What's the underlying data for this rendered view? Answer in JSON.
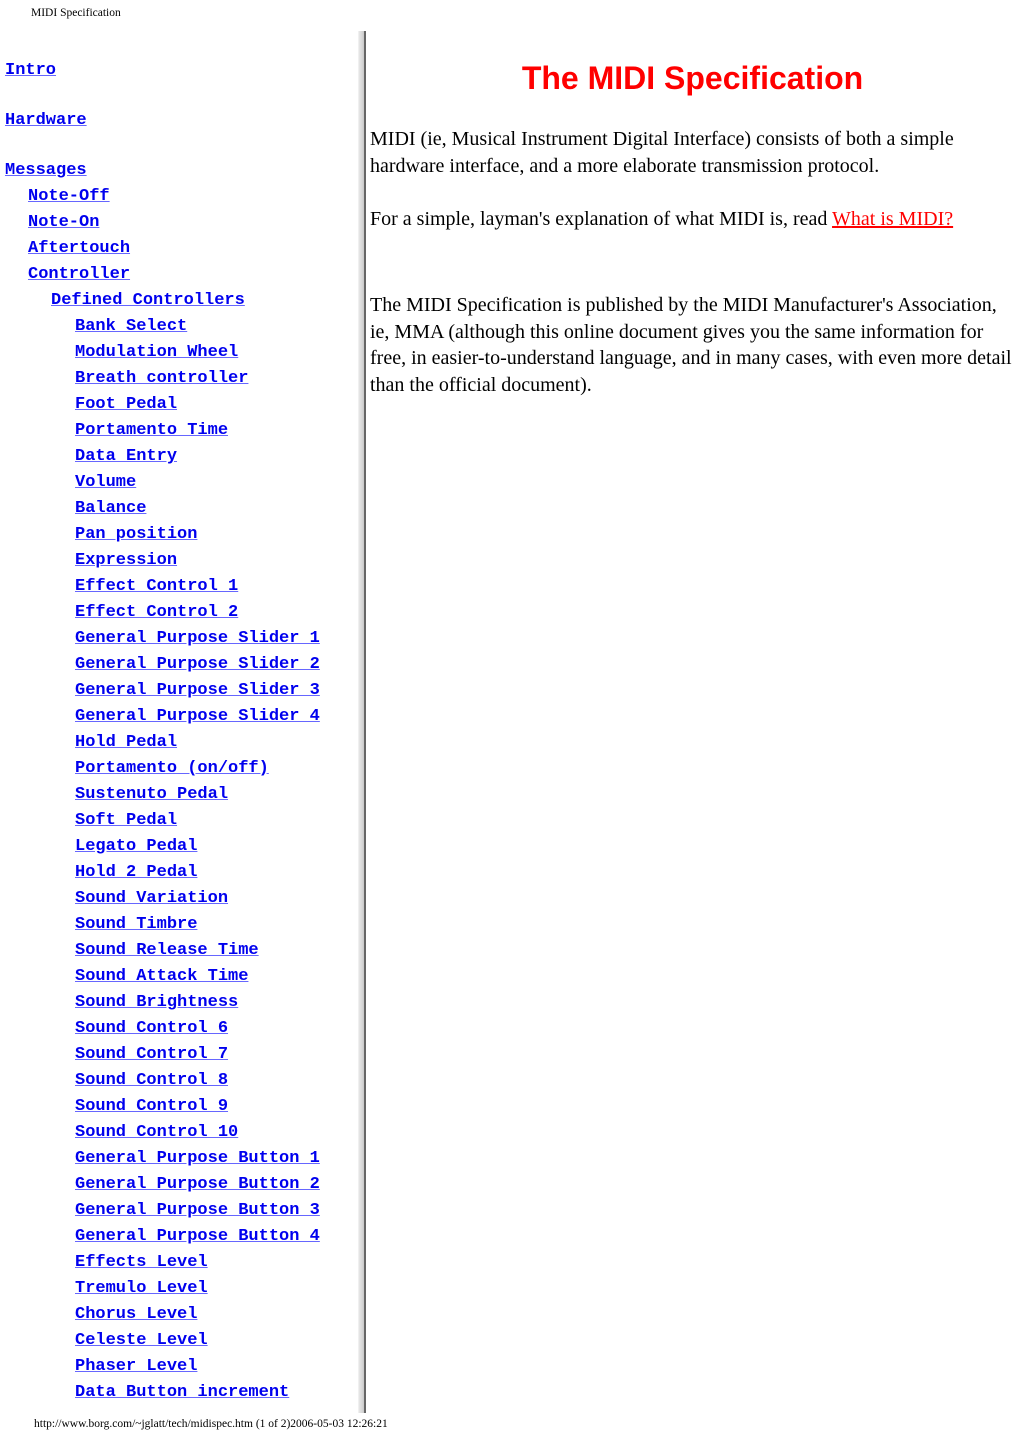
{
  "header": {
    "title": "MIDI Specification"
  },
  "nav": {
    "items": [
      {
        "label": "Intro",
        "level": 0,
        "gap": true
      },
      {
        "label": "Hardware",
        "level": 0,
        "gap": true
      },
      {
        "label": "Messages",
        "level": 0
      },
      {
        "label": "Note-Off",
        "level": 1
      },
      {
        "label": "Note-On",
        "level": 1
      },
      {
        "label": "Aftertouch",
        "level": 1
      },
      {
        "label": "Controller",
        "level": 1
      },
      {
        "label": "Defined Controllers",
        "level": 2
      },
      {
        "label": "Bank Select",
        "level": 3
      },
      {
        "label": "Modulation Wheel",
        "level": 3
      },
      {
        "label": "Breath controller",
        "level": 3
      },
      {
        "label": "Foot Pedal",
        "level": 3
      },
      {
        "label": "Portamento Time",
        "level": 3
      },
      {
        "label": "Data Entry",
        "level": 3
      },
      {
        "label": "Volume",
        "level": 3
      },
      {
        "label": "Balance",
        "level": 3
      },
      {
        "label": "Pan position",
        "level": 3
      },
      {
        "label": "Expression",
        "level": 3
      },
      {
        "label": "Effect Control 1",
        "level": 3
      },
      {
        "label": "Effect Control 2",
        "level": 3
      },
      {
        "label": "General Purpose Slider 1",
        "level": 3
      },
      {
        "label": "General Purpose Slider 2",
        "level": 3
      },
      {
        "label": "General Purpose Slider 3",
        "level": 3
      },
      {
        "label": "General Purpose Slider 4",
        "level": 3
      },
      {
        "label": "Hold Pedal",
        "level": 3
      },
      {
        "label": "Portamento (on/off)",
        "level": 3
      },
      {
        "label": "Sustenuto Pedal",
        "level": 3
      },
      {
        "label": "Soft Pedal",
        "level": 3
      },
      {
        "label": "Legato Pedal",
        "level": 3
      },
      {
        "label": "Hold 2 Pedal",
        "level": 3
      },
      {
        "label": "Sound Variation",
        "level": 3
      },
      {
        "label": "Sound Timbre",
        "level": 3
      },
      {
        "label": "Sound Release Time",
        "level": 3
      },
      {
        "label": "Sound Attack Time",
        "level": 3
      },
      {
        "label": "Sound Brightness",
        "level": 3
      },
      {
        "label": "Sound Control 6",
        "level": 3
      },
      {
        "label": "Sound Control 7",
        "level": 3
      },
      {
        "label": "Sound Control 8",
        "level": 3
      },
      {
        "label": "Sound Control 9",
        "level": 3
      },
      {
        "label": "Sound Control 10",
        "level": 3
      },
      {
        "label": "General Purpose Button 1",
        "level": 3
      },
      {
        "label": "General Purpose Button 2",
        "level": 3
      },
      {
        "label": "General Purpose Button 3",
        "level": 3
      },
      {
        "label": "General Purpose Button 4",
        "level": 3
      },
      {
        "label": "Effects Level",
        "level": 3
      },
      {
        "label": "Tremulo Level",
        "level": 3
      },
      {
        "label": "Chorus Level",
        "level": 3
      },
      {
        "label": "Celeste Level",
        "level": 3
      },
      {
        "label": "Phaser Level",
        "level": 3
      },
      {
        "label": "Data Button increment",
        "level": 3
      }
    ]
  },
  "main": {
    "title": "The MIDI Specification",
    "p1": "MIDI (ie, Musical Instrument Digital Interface) consists of both a simple hardware interface, and a more elaborate transmission protocol.",
    "p2_prefix": "For a simple, layman's explanation of what MIDI is, read ",
    "p2_link": "What is MIDI?",
    "p3": "The MIDI Specification is published by the MIDI Manufacturer's Association, ie, MMA (although this online document gives you the same information for free, in easier-to-understand language, and in many cases, with even more detail than the official document).",
    "link_color": "#ff0000",
    "title_color": "#ff0000"
  },
  "footer": {
    "text": "http://www.borg.com/~jglatt/tech/midispec.htm (1 of 2)2006-05-03 12:26:21"
  },
  "colors": {
    "nav_link": "#0000ee"
  }
}
